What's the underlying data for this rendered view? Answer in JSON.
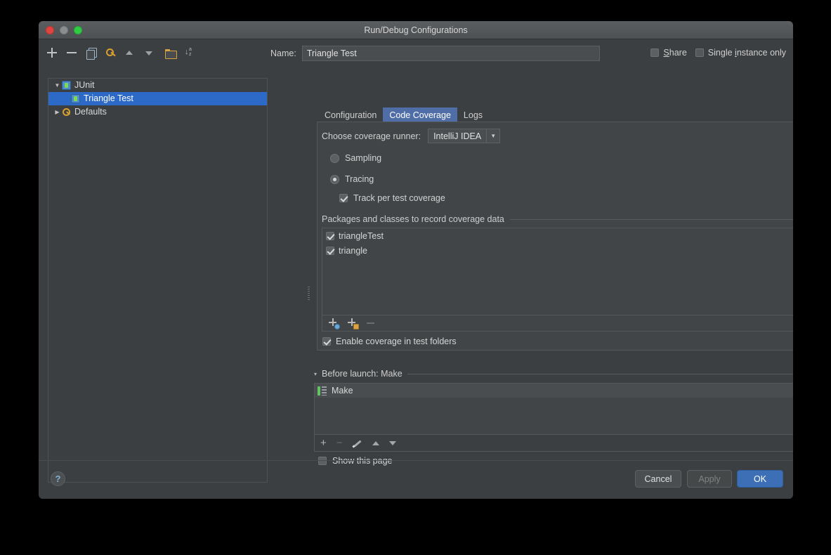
{
  "window": {
    "title": "Run/Debug Configurations",
    "traffic": {
      "close": "close-button",
      "minimize": "minimize-button",
      "maximize": "maximize-button"
    }
  },
  "left_toolbar": {
    "icons": [
      {
        "name": "add-icon",
        "label": "+"
      },
      {
        "name": "remove-icon",
        "label": "−"
      },
      {
        "name": "copy-icon",
        "label": "Copy"
      },
      {
        "name": "edit-defaults-icon",
        "label": "Edit defaults"
      },
      {
        "name": "move-up-icon",
        "label": "Move Up"
      },
      {
        "name": "move-down-icon",
        "label": "Move Down"
      },
      {
        "name": "folder-icon",
        "label": "Create folder"
      },
      {
        "name": "sort-alphabetically-icon",
        "label": "Sort alphabetically"
      }
    ]
  },
  "tree": {
    "items": [
      {
        "label": "JUnit",
        "expanded": true,
        "twisty": "▼",
        "icon": "junit-icon",
        "selected": false,
        "level": 0
      },
      {
        "label": "Triangle Test",
        "expanded": null,
        "twisty": "",
        "icon": "junit-icon",
        "selected": true,
        "level": 1
      },
      {
        "label": "Defaults",
        "expanded": false,
        "twisty": "▶",
        "icon": "wrench-icon",
        "selected": false,
        "level": 0
      }
    ]
  },
  "name_row": {
    "label": "Name:",
    "value": "Triangle Test",
    "placeholder": ""
  },
  "top_right": {
    "share": {
      "label_pre": "",
      "label": "Share",
      "mnemonic": "S",
      "checked": false
    },
    "single_instance": {
      "label": "Single instance only",
      "mnemonic": "i",
      "checked": false
    }
  },
  "tabs": [
    {
      "label": "Configuration",
      "active": false
    },
    {
      "label": "Code Coverage",
      "active": true
    },
    {
      "label": "Logs",
      "active": false
    }
  ],
  "coverage": {
    "runner_label": "Choose coverage runner:",
    "runner_value": "IntelliJ IDEA",
    "runner_arrow": "▼",
    "modes": [
      {
        "label": "Sampling",
        "selected": false
      },
      {
        "label": "Tracing",
        "selected": true
      }
    ],
    "track_per_test": {
      "label": "Track per test coverage",
      "checked": true
    },
    "packages_header": "Packages and classes to record coverage data",
    "packages": [
      {
        "label": "triangleTest",
        "checked": true
      },
      {
        "label": "triangle",
        "checked": true
      }
    ],
    "list_toolbar": [
      {
        "name": "add-class-icon",
        "label": "Add class"
      },
      {
        "name": "add-package-icon",
        "label": "Add package"
      },
      {
        "name": "remove-pattern-icon",
        "label": "Remove",
        "disabled": true
      }
    ],
    "enable_test_folders": {
      "label": "Enable coverage in test folders",
      "checked": true
    }
  },
  "before_launch": {
    "caret": "▾",
    "header": "Before launch: Make",
    "tasks": [
      {
        "label": "Make",
        "icon": "make-icon"
      }
    ],
    "toolbar": [
      {
        "name": "add-task-icon",
        "label": "+"
      },
      {
        "name": "remove-task-icon",
        "label": "−",
        "disabled": true
      },
      {
        "name": "edit-task-icon",
        "label": "Edit"
      },
      {
        "name": "move-task-up-icon",
        "label": "Up"
      },
      {
        "name": "move-task-down-icon",
        "label": "Down"
      }
    ],
    "show_page": {
      "label": "Show this page",
      "checked": false
    }
  },
  "footer": {
    "help": "?",
    "cancel": "Cancel",
    "apply": "Apply",
    "ok": "OK"
  },
  "colors": {
    "window_bg": "#3c3f41",
    "panel_bg": "#424547",
    "selection_blue": "#2d6ac7",
    "tab_active_blue": "#4f6ea8",
    "ok_blue": "#3c6fb5",
    "text": "#d6d6d6"
  }
}
